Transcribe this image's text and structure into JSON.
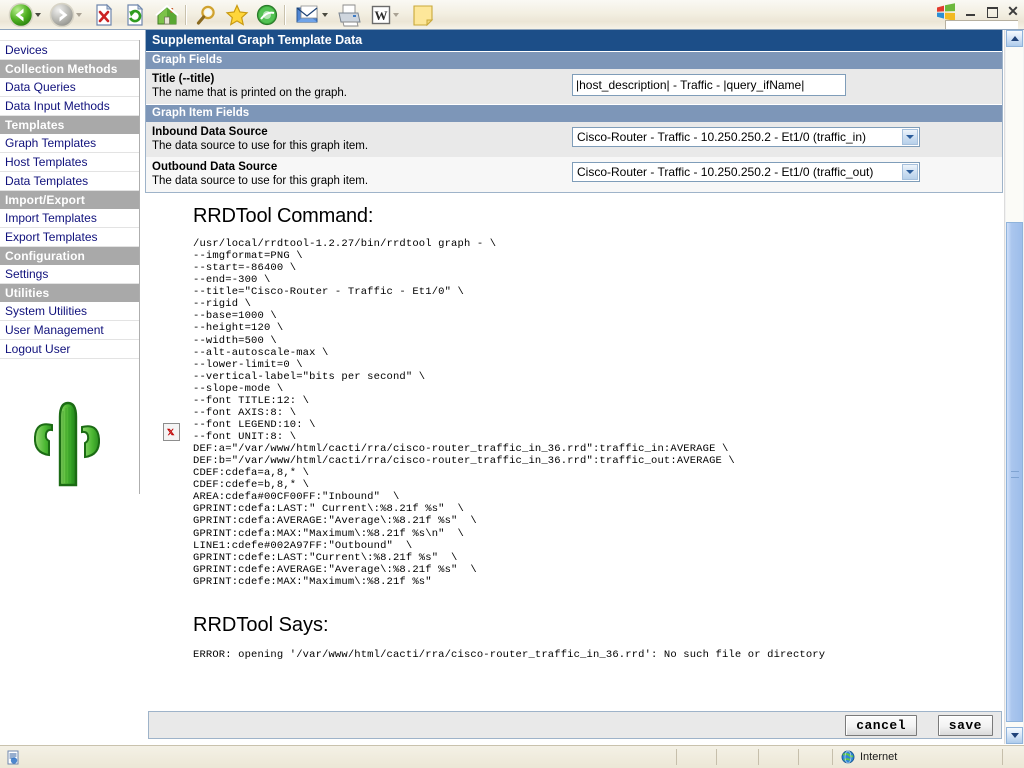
{
  "browser": {
    "toolbar_icons": [
      {
        "name": "back-icon",
        "label": "Back"
      },
      {
        "name": "forward-icon",
        "label": "Forward"
      },
      {
        "name": "stop-icon",
        "label": "Stop"
      },
      {
        "name": "refresh-icon",
        "label": "Refresh"
      },
      {
        "name": "home-icon",
        "label": "Home"
      },
      {
        "name": "search-icon",
        "label": "Search"
      },
      {
        "name": "favorites-icon",
        "label": "Favorites"
      },
      {
        "name": "history-icon",
        "label": "History"
      },
      {
        "name": "mail-icon",
        "label": "Mail"
      },
      {
        "name": "print-icon",
        "label": "Print"
      },
      {
        "name": "edit-word-icon",
        "label": "Edit with Word"
      },
      {
        "name": "notes-icon",
        "label": "Notes"
      }
    ],
    "window_controls": {
      "minimize": "minimize-button",
      "maximize": "maximize-button",
      "close": "close-button"
    },
    "statusbar": {
      "zone_label": "Internet",
      "zone_icon": "globe-icon",
      "page_icon": "page-icon"
    },
    "scrollbar": {
      "up_arrow": "scroll-up-arrow",
      "down_arrow": "scroll-down-arrow",
      "thumb": "scroll-thumb"
    }
  },
  "sidebar": {
    "logo_alt": "cacti-cactus-logo",
    "items": [
      {
        "label": "Devices",
        "type": "link"
      },
      {
        "label": "Collection Methods",
        "type": "header"
      },
      {
        "label": "Data Queries",
        "type": "link"
      },
      {
        "label": "Data Input Methods",
        "type": "link"
      },
      {
        "label": "Templates",
        "type": "header"
      },
      {
        "label": "Graph Templates",
        "type": "link"
      },
      {
        "label": "Host Templates",
        "type": "link"
      },
      {
        "label": "Data Templates",
        "type": "link"
      },
      {
        "label": "Import/Export",
        "type": "header"
      },
      {
        "label": "Import Templates",
        "type": "link"
      },
      {
        "label": "Export Templates",
        "type": "link"
      },
      {
        "label": "Configuration",
        "type": "header"
      },
      {
        "label": "Settings",
        "type": "link"
      },
      {
        "label": "Utilities",
        "type": "header"
      },
      {
        "label": "System Utilities",
        "type": "link"
      },
      {
        "label": "User Management",
        "type": "link"
      },
      {
        "label": "Logout User",
        "type": "link"
      }
    ]
  },
  "panel": {
    "title": "Supplemental Graph Template Data",
    "graph_fields": {
      "section_label": "Graph Fields",
      "title_field": {
        "label": "Title (--title)",
        "description": "The name that is printed on the graph.",
        "value": "|host_description| - Traffic - |query_ifName|",
        "placeholder": ""
      }
    },
    "graph_item_fields": {
      "section_label": "Graph Item Fields",
      "inbound": {
        "label": "Inbound Data Source",
        "description": "The data source to use for this graph item.",
        "value": "Cisco-Router - Traffic - 10.250.250.2 - Et1/0 (traffic_in)"
      },
      "outbound": {
        "label": "Outbound Data Source",
        "description": "The data source to use for this graph item.",
        "value": "Cisco-Router - Traffic - 10.250.250.2 - Et1/0 (traffic_out)"
      }
    }
  },
  "rrdtool": {
    "command_heading": "RRDTool Command:",
    "command": "/usr/local/rrdtool-1.2.27/bin/rrdtool graph - \\\n--imgformat=PNG \\\n--start=-86400 \\\n--end=-300 \\\n--title=\"Cisco-Router - Traffic - Et1/0\" \\\n--rigid \\\n--base=1000 \\\n--height=120 \\\n--width=500 \\\n--alt-autoscale-max \\\n--lower-limit=0 \\\n--vertical-label=\"bits per second\" \\\n--slope-mode \\\n--font TITLE:12: \\\n--font AXIS:8: \\\n--font LEGEND:10: \\\n--font UNIT:8: \\\nDEF:a=\"/var/www/html/cacti/rra/cisco-router_traffic_in_36.rrd\":traffic_in:AVERAGE \\\nDEF:b=\"/var/www/html/cacti/rra/cisco-router_traffic_in_36.rrd\":traffic_out:AVERAGE \\\nCDEF:cdefa=a,8,* \\\nCDEF:cdefe=b,8,* \\\nAREA:cdefa#00CF00FF:\"Inbound\"  \\\nGPRINT:cdefa:LAST:\" Current\\:%8.21f %s\"  \\\nGPRINT:cdefa:AVERAGE:\"Average\\:%8.21f %s\"  \\\nGPRINT:cdefa:MAX:\"Maximum\\:%8.21f %s\\n\"  \\\nLINE1:cdefe#002A97FF:\"Outbound\"  \\\nGPRINT:cdefe:LAST:\"Current\\:%8.21f %s\"  \\\nGPRINT:cdefe:AVERAGE:\"Average\\:%8.21f %s\"  \\\nGPRINT:cdefe:MAX:\"Maximum\\:%8.21f %s\"",
    "says_heading": "RRDTool Says:",
    "says_text": "ERROR: opening '/var/www/html/cacti/rra/cisco-router_traffic_in_36.rrd': No such file or directory",
    "broken_image_alt": "broken-image-placeholder"
  },
  "buttons": {
    "cancel": "cancel",
    "save": "save"
  },
  "colors": {
    "panel_title_bg": "#1c4e88",
    "section_bar_bg": "#7d96b8",
    "nav_header_bg": "#a9a9a9",
    "nav_link_color": "#10117c",
    "field_row_bg": "#e9e9e9"
  }
}
